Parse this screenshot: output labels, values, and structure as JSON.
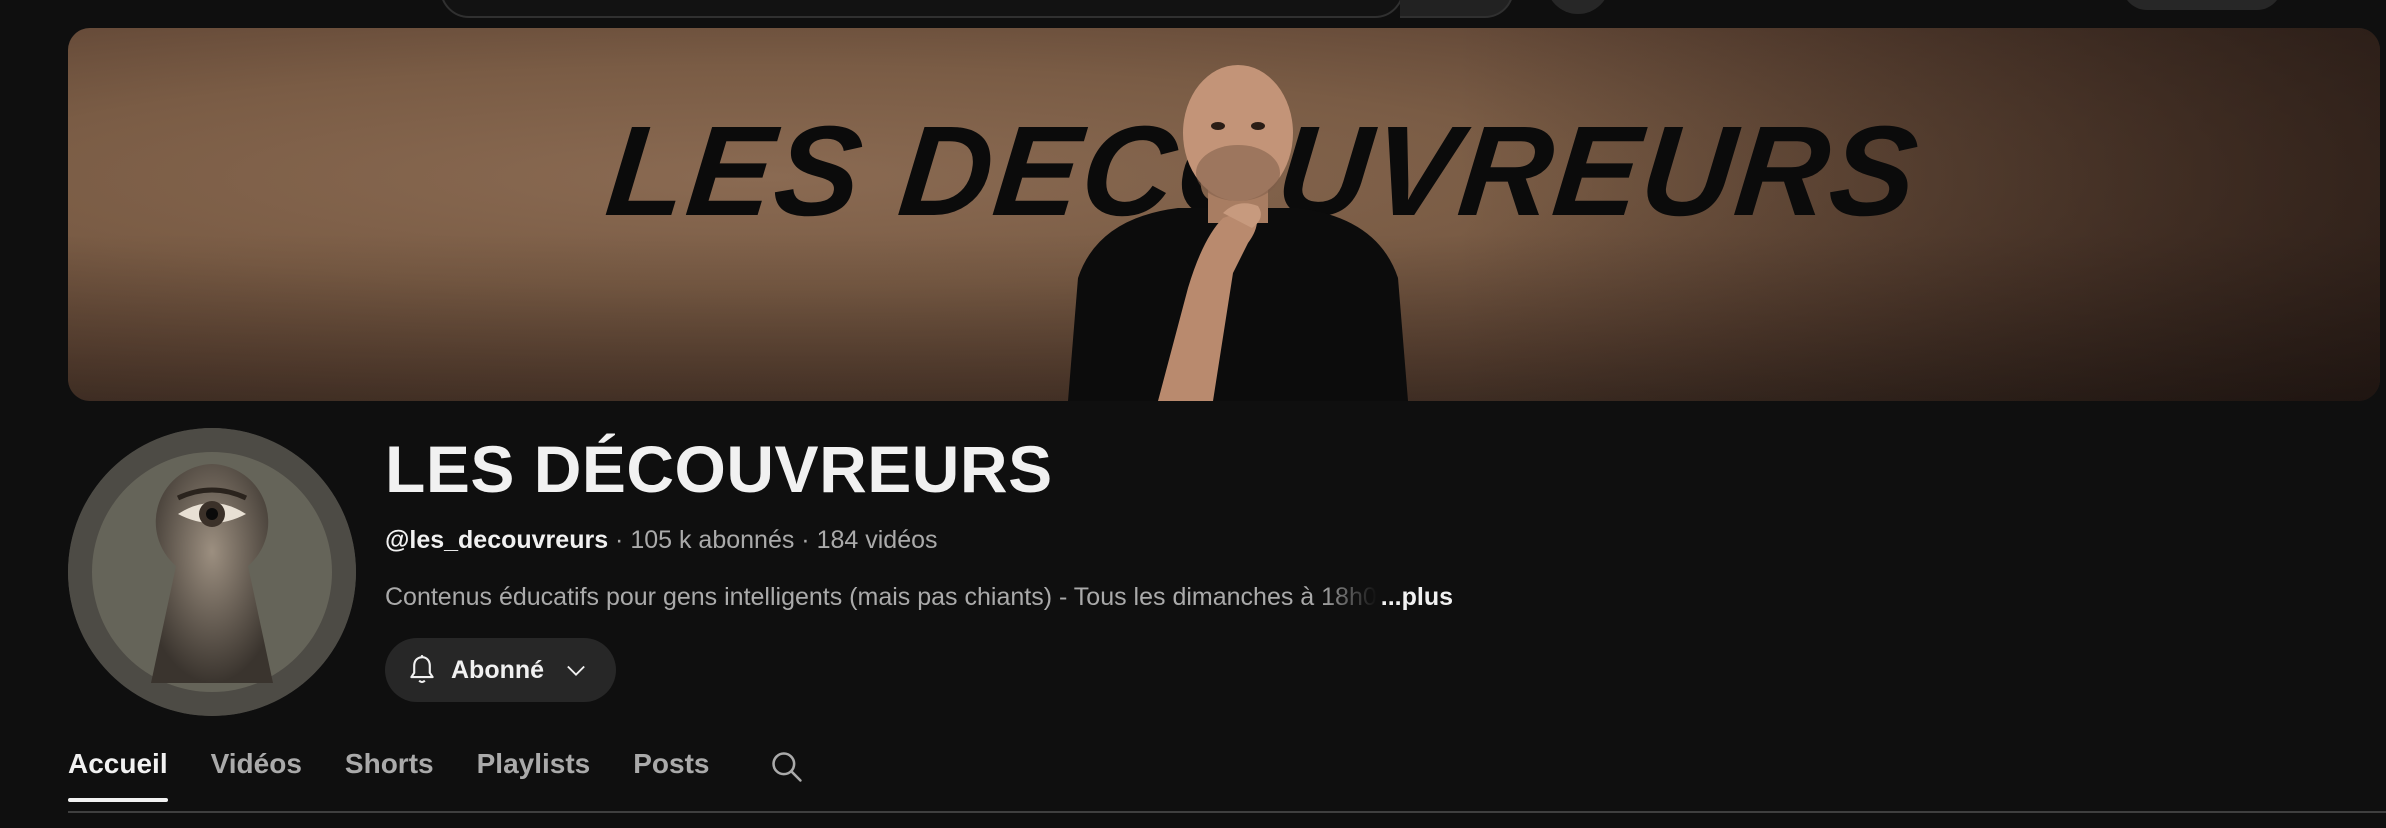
{
  "banner": {
    "title": "LES DECOUVREURS"
  },
  "channel": {
    "name": "LES DÉCOUVREURS",
    "handle": "@les_decouvreurs",
    "separator": " · ",
    "subscribers": "105 k abonnés",
    "videos": "184 vidéos",
    "description": "Contenus éducatifs pour gens intelligents (mais pas chiants) - Tous les dimanches à ",
    "description_faded": "18h0",
    "more_label": "...plus"
  },
  "subscribe": {
    "label": "Abonné",
    "icon": "bell-icon",
    "dropdown_icon": "chevron-down-icon"
  },
  "tabs": [
    {
      "label": "Accueil",
      "active": true
    },
    {
      "label": "Vidéos",
      "active": false
    },
    {
      "label": "Shorts",
      "active": false
    },
    {
      "label": "Playlists",
      "active": false
    },
    {
      "label": "Posts",
      "active": false
    }
  ],
  "colors": {
    "background": "#0f0f0f",
    "text_primary": "#f1f1f1",
    "text_secondary": "#aaaaaa",
    "button_bg": "#272727"
  }
}
